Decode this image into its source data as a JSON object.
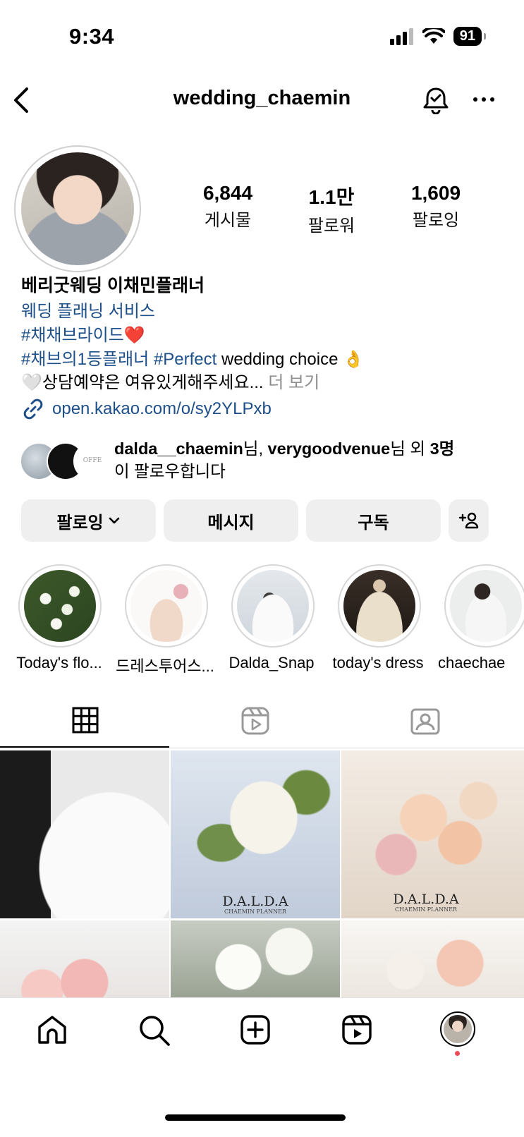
{
  "status_bar": {
    "time": "9:34",
    "battery": "91"
  },
  "header": {
    "username": "wedding_chaemin"
  },
  "profile": {
    "stats": [
      {
        "value": "6,844",
        "label": "게시물"
      },
      {
        "value": "1.1만",
        "label": "팔로워"
      },
      {
        "value": "1,609",
        "label": "팔로잉"
      }
    ],
    "name": "베리굿웨딩 이채민플래너",
    "category": "웨딩 플래닝 서비스",
    "bio_line1": "#채채브라이드❤️",
    "bio_line2_tags": "#채브의1등플래너 #Perfect",
    "bio_line2_text": " wedding choice 👌",
    "bio_line3": "🤍상담예약은 여유있게해주세요...",
    "bio_more": " 더 보기",
    "link": "open.kakao.com/o/sy2YLPxb"
  },
  "followed_by": {
    "user1": "dalda__chaemin",
    "suffix1": "님, ",
    "user2": "verygoodvenue",
    "suffix2": "님 외 ",
    "count": "3명",
    "line2": "이 팔로우합니다"
  },
  "actions": {
    "following": "팔로잉",
    "message": "메시지",
    "subscribe": "구독"
  },
  "highlights": [
    {
      "label": "Today's flo..."
    },
    {
      "label": "드레스투어스..."
    },
    {
      "label": "Dalda_Snap"
    },
    {
      "label": "today's dress"
    },
    {
      "label": "chaechae"
    }
  ],
  "grid": {
    "brand": "D.A.L.D.A",
    "sub": "CHAEMIN PLANNER"
  },
  "icons": [
    "back-icon",
    "bell-icon",
    "more-icon",
    "link-icon",
    "chevron-down-icon",
    "add-person-icon",
    "grid-icon",
    "reels-icon",
    "tagged-icon",
    "home-icon",
    "search-icon",
    "create-icon",
    "reels-nav-icon",
    "profile-avatar-icon"
  ],
  "colors": {
    "link_blue": "#1d4f8a",
    "button_bg": "#efefef",
    "notification_dot": "#ed4956"
  }
}
